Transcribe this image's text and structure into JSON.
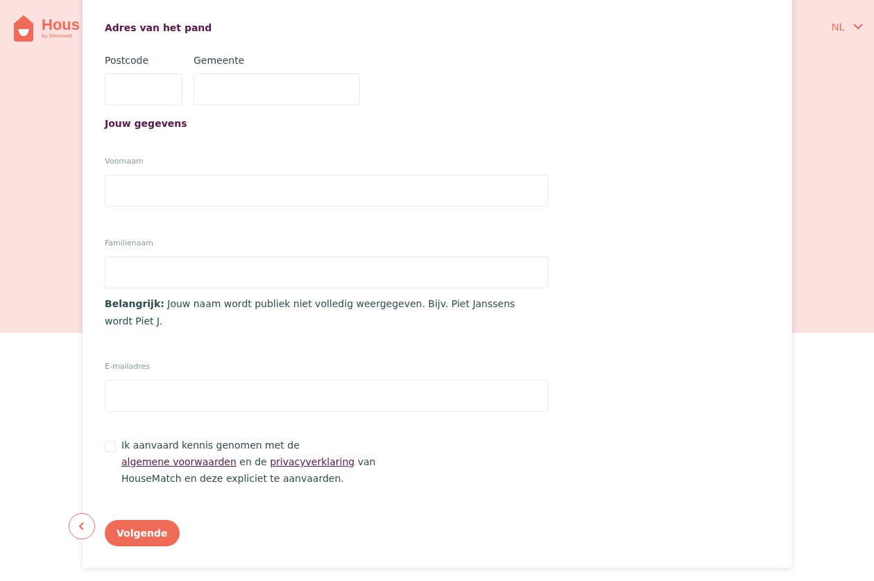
{
  "header": {
    "logo_text": "Hous",
    "logo_subtext": "by Smooved",
    "language": "NL"
  },
  "address": {
    "title": "Adres van het pand",
    "fields": [
      {
        "label": "Postcode",
        "kind": "short"
      },
      {
        "label": "Gemeente",
        "kind": "medium"
      }
    ]
  },
  "personal": {
    "title": "Jouw gegevens",
    "fields": [
      {
        "label": "Voornaam"
      },
      {
        "label": "Familienaam",
        "note": "**Belangrijk:** Jouw naam wordt publiek niet volledig weergegeven. Bijv. Piet Janssens wordt Piet J."
      },
      {
        "label": "E-mailadres"
      }
    ]
  },
  "consent": {
    "checked": false,
    "parts": [
      {
        "kind": "text",
        "text": "Ik aanvaard kennis genomen met de "
      },
      {
        "kind": "link",
        "text": "algemene voorwaarden"
      },
      {
        "kind": "text",
        "text": " en de "
      },
      {
        "kind": "link",
        "text": "privacyverklaring"
      },
      {
        "kind": "text",
        "text": " van HouseMatch en deze expliciet te aanvaarden."
      }
    ]
  },
  "buttons": {
    "next": "Volgende"
  }
}
